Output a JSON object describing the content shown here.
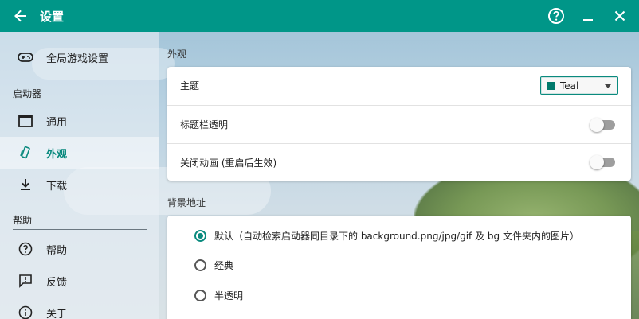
{
  "colors": {
    "primary": "#009688",
    "accent": "#0a8a7e",
    "theme_swatch": "#00796b"
  },
  "titlebar": {
    "title": "设置",
    "icons": [
      "arrow-left-icon",
      "help-circle-icon",
      "minimize-icon",
      "close-icon"
    ]
  },
  "sidebar": {
    "global": {
      "label": "全局游戏设置",
      "icon": "gamepad-icon"
    },
    "launcher_header": "启动器",
    "launcher_items": [
      {
        "label": "通用",
        "icon": "window-icon"
      },
      {
        "label": "外观",
        "icon": "palette-icon",
        "active": true
      },
      {
        "label": "下载",
        "icon": "download-icon"
      }
    ],
    "help_header": "帮助",
    "help_items": [
      {
        "label": "帮助",
        "icon": "help-icon"
      },
      {
        "label": "反馈",
        "icon": "feedback-icon"
      },
      {
        "label": "关于",
        "icon": "info-icon"
      }
    ]
  },
  "appearance": {
    "section_label": "外观",
    "theme": {
      "label": "主题",
      "value": "Teal"
    },
    "transparent_titlebar": {
      "label": "标题栏透明",
      "enabled": false
    },
    "disable_animation": {
      "label": "关闭动画 (重启后生效)",
      "enabled": false
    }
  },
  "background": {
    "section_label": "背景地址",
    "options": [
      {
        "label": "默认（自动检索启动器同目录下的 background.png/jpg/gif 及 bg 文件夹内的图片）",
        "selected": true
      },
      {
        "label": "经典",
        "selected": false
      },
      {
        "label": "半透明",
        "selected": false
      }
    ]
  }
}
